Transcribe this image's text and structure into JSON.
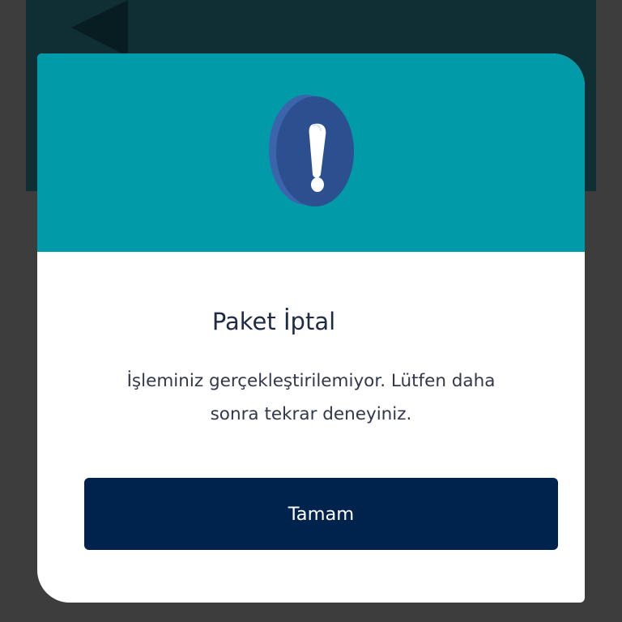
{
  "background": {
    "screen_color": "#0f2f35",
    "overlay_color": "#3d3d3d",
    "icon": "play-back-icon"
  },
  "dialog": {
    "header_color": "#009aa8",
    "icon": "exclamation-alert-icon",
    "title": "Paket İptal",
    "message_line1": "İşleminiz gerçekleştirilemiyor. Lütfen daha",
    "message_line2": "sonra tekrar deneyiniz.",
    "button_label": "Tamam",
    "button_color": "#00234e"
  }
}
